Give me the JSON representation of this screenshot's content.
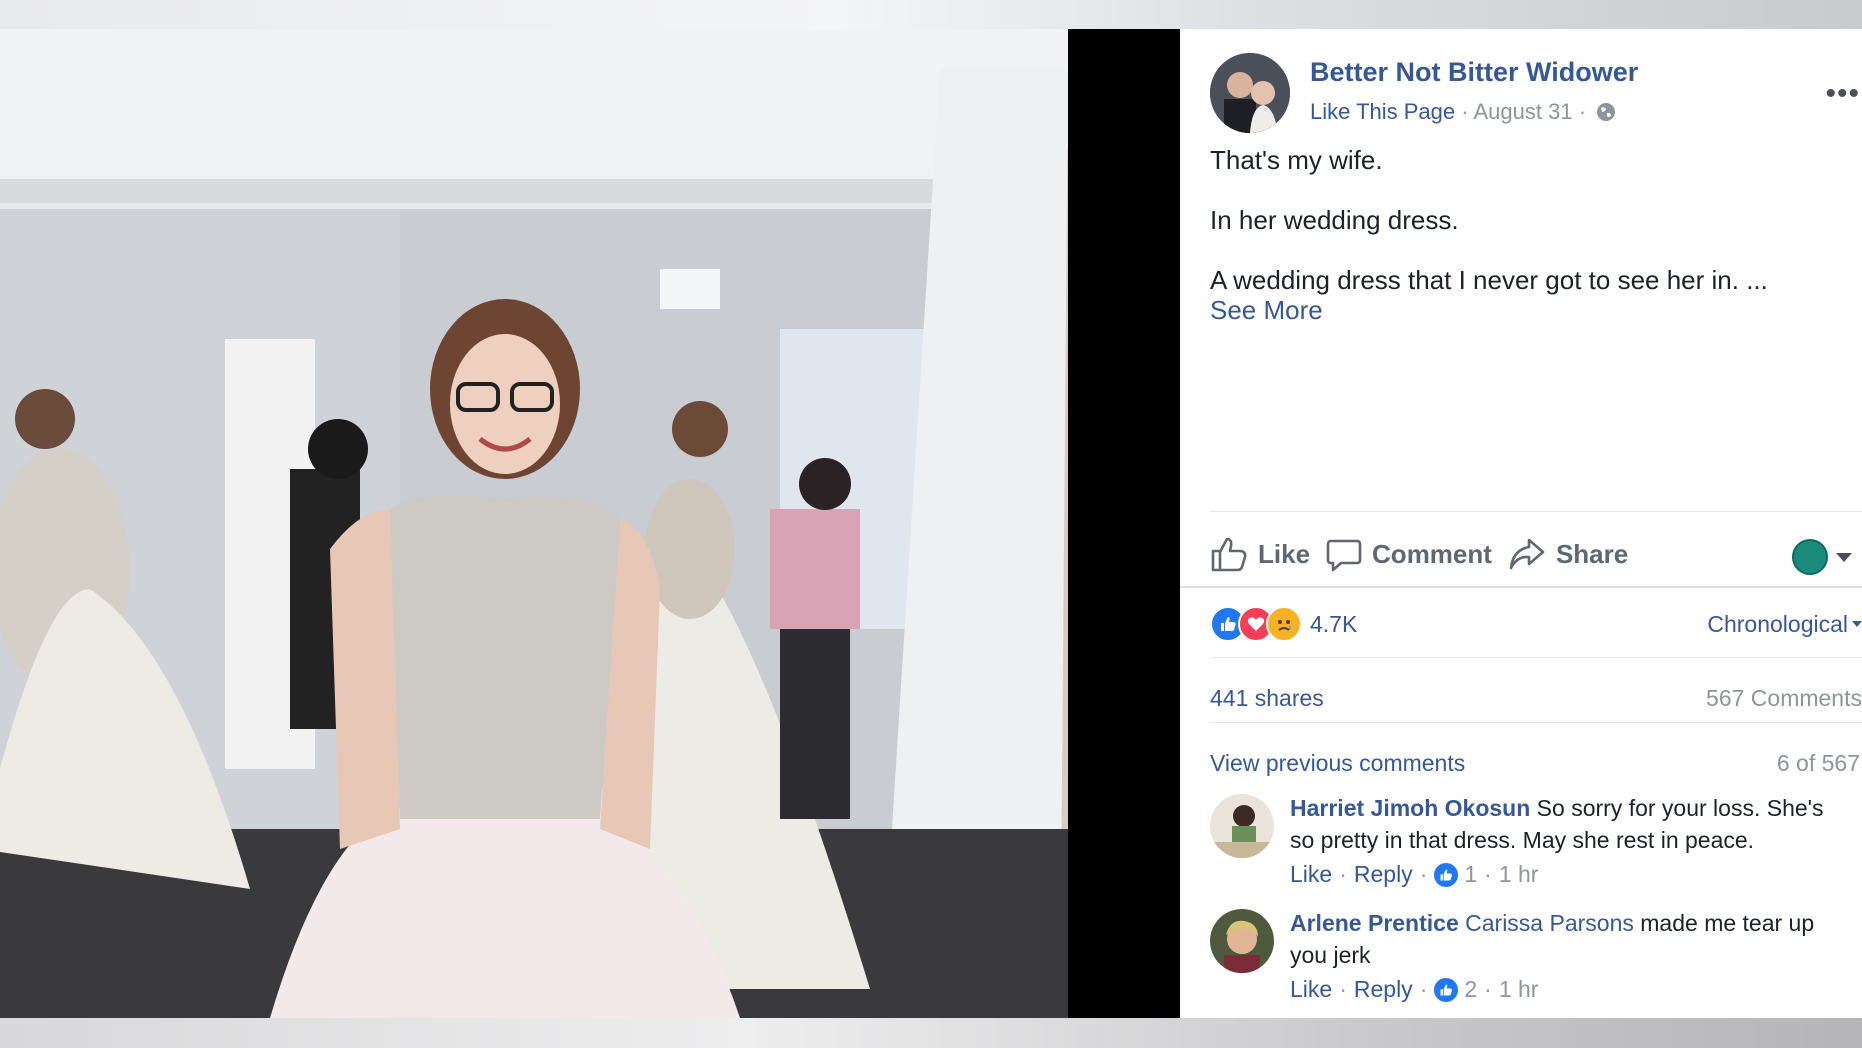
{
  "post": {
    "page_name": "Better Not Bitter Widower",
    "like_page": "Like This Page",
    "date": "August 31",
    "lines": [
      "That's my wife.",
      "In her wedding dress.",
      "A wedding dress that I never got to see her in. ..."
    ],
    "see_more": "See More"
  },
  "actions": {
    "like": "Like",
    "comment": "Comment",
    "share": "Share"
  },
  "stats": {
    "reaction_count": "4.7K",
    "order": "Chronological",
    "shares": "441 shares",
    "comments": "567 Comments",
    "view_previous": "View previous comments",
    "range": "6 of 567"
  },
  "comments": [
    {
      "name": "Harriet Jimoh Okosun",
      "text": "So sorry for your loss. She's so pretty in that dress. May she rest in peace.",
      "like": "Like",
      "reply": "Reply",
      "likes": "1",
      "time": "1 hr"
    },
    {
      "name": "Arlene Prentice",
      "mention": "Carissa Parsons",
      "text": "made me tear up you jerk",
      "like": "Like",
      "reply": "Reply",
      "likes": "2",
      "time": "1 hr"
    }
  ],
  "colors": {
    "link": "#365899",
    "meta": "#90949c",
    "text": "#1d2129",
    "like_blue": "#2078f4",
    "love_red": "#f33e58",
    "sad_yellow": "#f7b125"
  }
}
